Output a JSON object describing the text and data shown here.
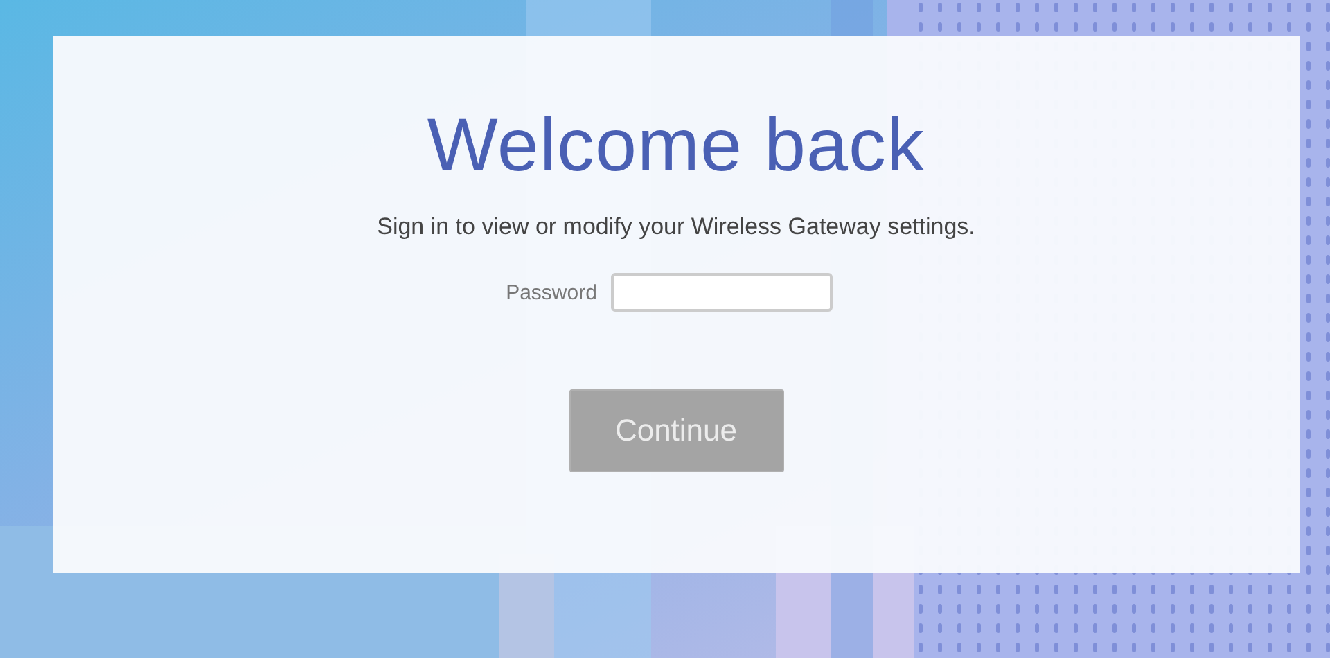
{
  "heading": "Welcome back",
  "intro": "Sign in to view or modify your Wireless Gateway settings.",
  "password": {
    "label": "Password"
  },
  "continue_button": {
    "label": "Continue",
    "disabled": true
  }
}
